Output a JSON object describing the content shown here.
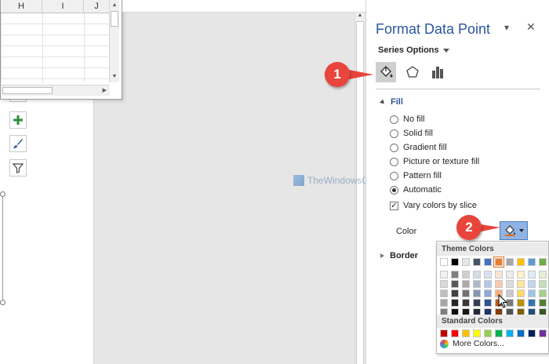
{
  "spreadsheet": {
    "columns": [
      "H",
      "I",
      "J"
    ]
  },
  "chart_tools": [
    "add-chart-element",
    "chart-styles",
    "chart-filters"
  ],
  "watermark": {
    "text": "TheWindowsClub"
  },
  "pane": {
    "title": "Format Data Point",
    "series_options_label": "Series Options",
    "tabs": [
      "fill-line",
      "effects",
      "series-options"
    ],
    "fill_section": {
      "label": "Fill",
      "options": [
        {
          "label": "No fill",
          "selected": false
        },
        {
          "label": "Solid fill",
          "selected": false
        },
        {
          "label": "Gradient fill",
          "selected": false
        },
        {
          "label": "Picture or texture fill",
          "selected": false
        },
        {
          "label": "Pattern fill",
          "selected": false
        },
        {
          "label": "Automatic",
          "selected": true
        }
      ],
      "vary_colors_label": "Vary colors by slice",
      "vary_colors_checked": true,
      "color_label": "Color"
    },
    "border_section": {
      "label": "Border"
    }
  },
  "palette": {
    "theme_label": "Theme Colors",
    "standard_label": "Standard Colors",
    "more_label": "More Colors...",
    "theme_colors": [
      [
        "#FFFFFF",
        "#F2F2F2",
        "#D9D9D9",
        "#BFBFBF",
        "#A6A6A6",
        "#808080"
      ],
      [
        "#000000",
        "#808080",
        "#595959",
        "#404040",
        "#262626",
        "#0D0D0D"
      ],
      [
        "#E7E6E6",
        "#D0CECE",
        "#AEAAAA",
        "#757171",
        "#3A3838",
        "#171616"
      ],
      [
        "#44546A",
        "#D6DCE4",
        "#ADB9CA",
        "#8497B0",
        "#333F4F",
        "#222A35"
      ],
      [
        "#4472C4",
        "#D9E2F3",
        "#B4C6E7",
        "#8EAADB",
        "#2F5496",
        "#1F3864"
      ],
      [
        "#ED7D31",
        "#FBE5D5",
        "#F7CAAC",
        "#F4B183",
        "#C55A11",
        "#833C0B"
      ],
      [
        "#A5A5A5",
        "#EDEDED",
        "#DBDBDB",
        "#C9C9C9",
        "#7B7B7B",
        "#525252"
      ],
      [
        "#FFC000",
        "#FFF2CC",
        "#FFE599",
        "#FFD966",
        "#BF9000",
        "#7F6000"
      ],
      [
        "#5B9BD5",
        "#DEEBF6",
        "#BDD7EE",
        "#9DC3E6",
        "#2E75B5",
        "#1F4E79"
      ],
      [
        "#70AD47",
        "#E2EFD9",
        "#C5E0B3",
        "#A8D08D",
        "#538135",
        "#375623"
      ]
    ],
    "standard_colors": [
      "#C00000",
      "#FF0000",
      "#FFC000",
      "#FFFF00",
      "#92D050",
      "#00B050",
      "#00B0F0",
      "#0070C0",
      "#002060",
      "#7030A0"
    ]
  },
  "callouts": [
    "1",
    "2"
  ]
}
